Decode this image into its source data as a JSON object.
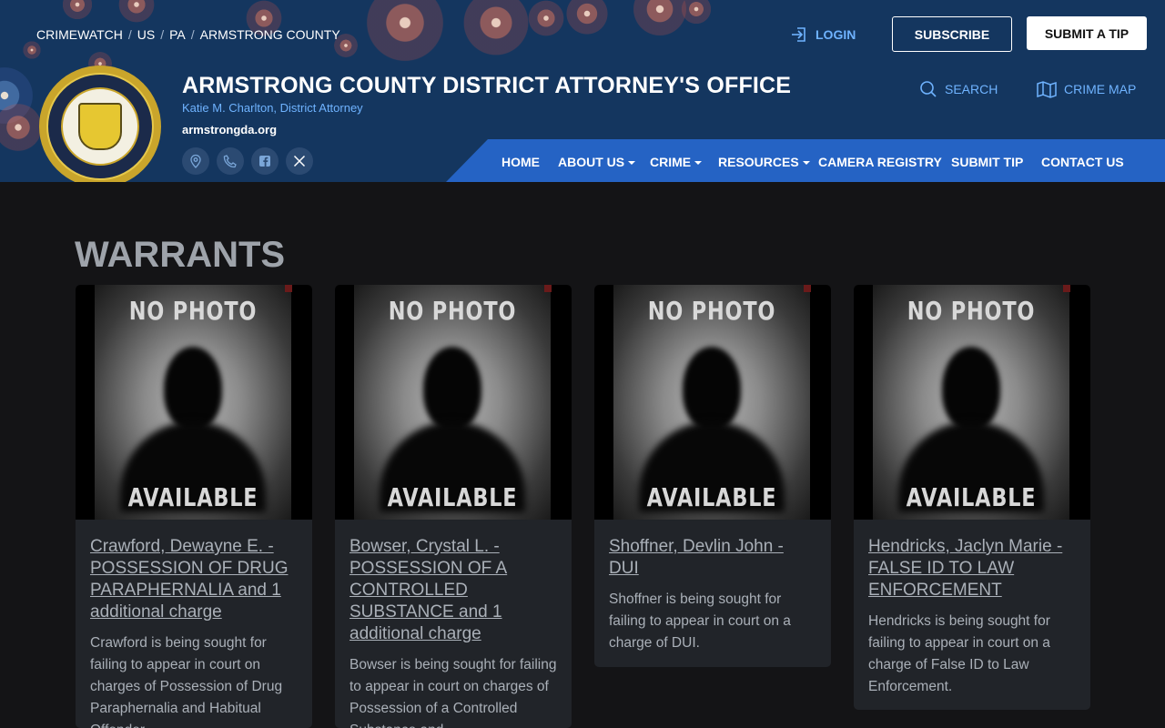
{
  "breadcrumb": [
    "CRIMEWATCH",
    "US",
    "PA",
    "ARMSTRONG COUNTY"
  ],
  "header": {
    "login": "LOGIN",
    "subscribe": "SUBSCRIBE",
    "submit_tip": "SUBMIT A TIP",
    "title": "ARMSTRONG COUNTY DISTRICT ATTORNEY'S OFFICE",
    "subtitle": "Katie M. Charlton, District Attorney",
    "url": "armstrongda.org",
    "search": "SEARCH",
    "crime_map": "CRIME MAP"
  },
  "nav": [
    {
      "label": "HOME",
      "dropdown": false
    },
    {
      "label": "ABOUT US",
      "dropdown": true
    },
    {
      "label": "CRIME",
      "dropdown": true
    },
    {
      "label": "RESOURCES",
      "dropdown": true
    },
    {
      "label": "CAMERA REGISTRY",
      "dropdown": false
    },
    {
      "label": "SUBMIT TIP",
      "dropdown": false
    },
    {
      "label": "CONTACT US",
      "dropdown": false
    }
  ],
  "page_title": "WARRANTS",
  "photo_placeholder": {
    "top": "NO PHOTO",
    "bottom": "AVAILABLE"
  },
  "cards": [
    {
      "title": "Crawford, Dewayne E. - POSSESSION OF DRUG PARAPHERNALIA and 1 additional charge",
      "text": "Crawford is being sought for failing to appear in court on charges of Possession of Drug Paraphernalia and Habitual Offender."
    },
    {
      "title": "Bowser, Crystal L. - POSSESSION OF A CONTROLLED SUBSTANCE and 1 additional charge",
      "text": "Bowser is being sought for failing to appear in court on charges of Possession of a Controlled Substance and"
    },
    {
      "title": "Shoffner, Devlin John - DUI",
      "text": "Shoffner is being sought for failing to appear in court on a charge of DUI."
    },
    {
      "title": "Hendricks, Jaclyn Marie - FALSE ID TO LAW ENFORCEMENT",
      "text": "Hendricks is being sought for failing to appear in court on a charge of False ID to Law Enforcement."
    }
  ]
}
